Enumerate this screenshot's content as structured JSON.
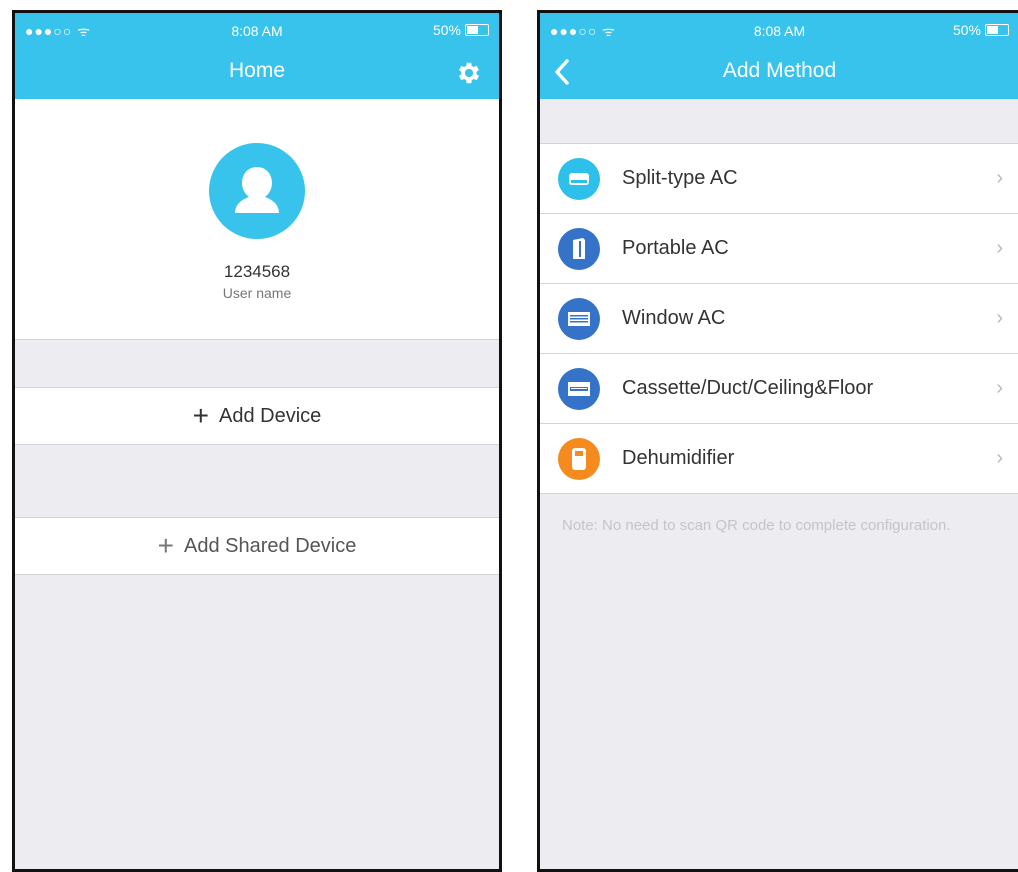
{
  "home_screen": {
    "status": {
      "signal": "●●●○○ ᯤ",
      "time": "8:08 AM",
      "battery": "50%"
    },
    "title": "Home",
    "user": {
      "id": "1234568",
      "name_label": "User name"
    },
    "add_device_label": "Add Device",
    "add_shared_device_label": "Add Shared Device"
  },
  "add_method_screen": {
    "status": {
      "signal": "●●●○○ ᯤ",
      "time": "8:08 AM",
      "battery": "50%"
    },
    "title": "Add Method",
    "items": [
      {
        "label": "Split-type AC",
        "icon": "split-type-ac-icon",
        "color": "#2ec0ea"
      },
      {
        "label": "Portable AC",
        "icon": "portable-ac-icon",
        "color": "#3573c8"
      },
      {
        "label": "Window AC",
        "icon": "window-ac-icon",
        "color": "#3573c8"
      },
      {
        "label": "Cassette/Duct/Ceiling&Floor",
        "icon": "cassette-ac-icon",
        "color": "#3573c8"
      },
      {
        "label": "Dehumidifier",
        "icon": "dehumidifier-icon",
        "color": "#f58a1f"
      }
    ],
    "note": "Note: No need to scan QR code to complete configuration."
  },
  "colors": {
    "accent": "#38c3ec",
    "background": "#ececf1"
  }
}
